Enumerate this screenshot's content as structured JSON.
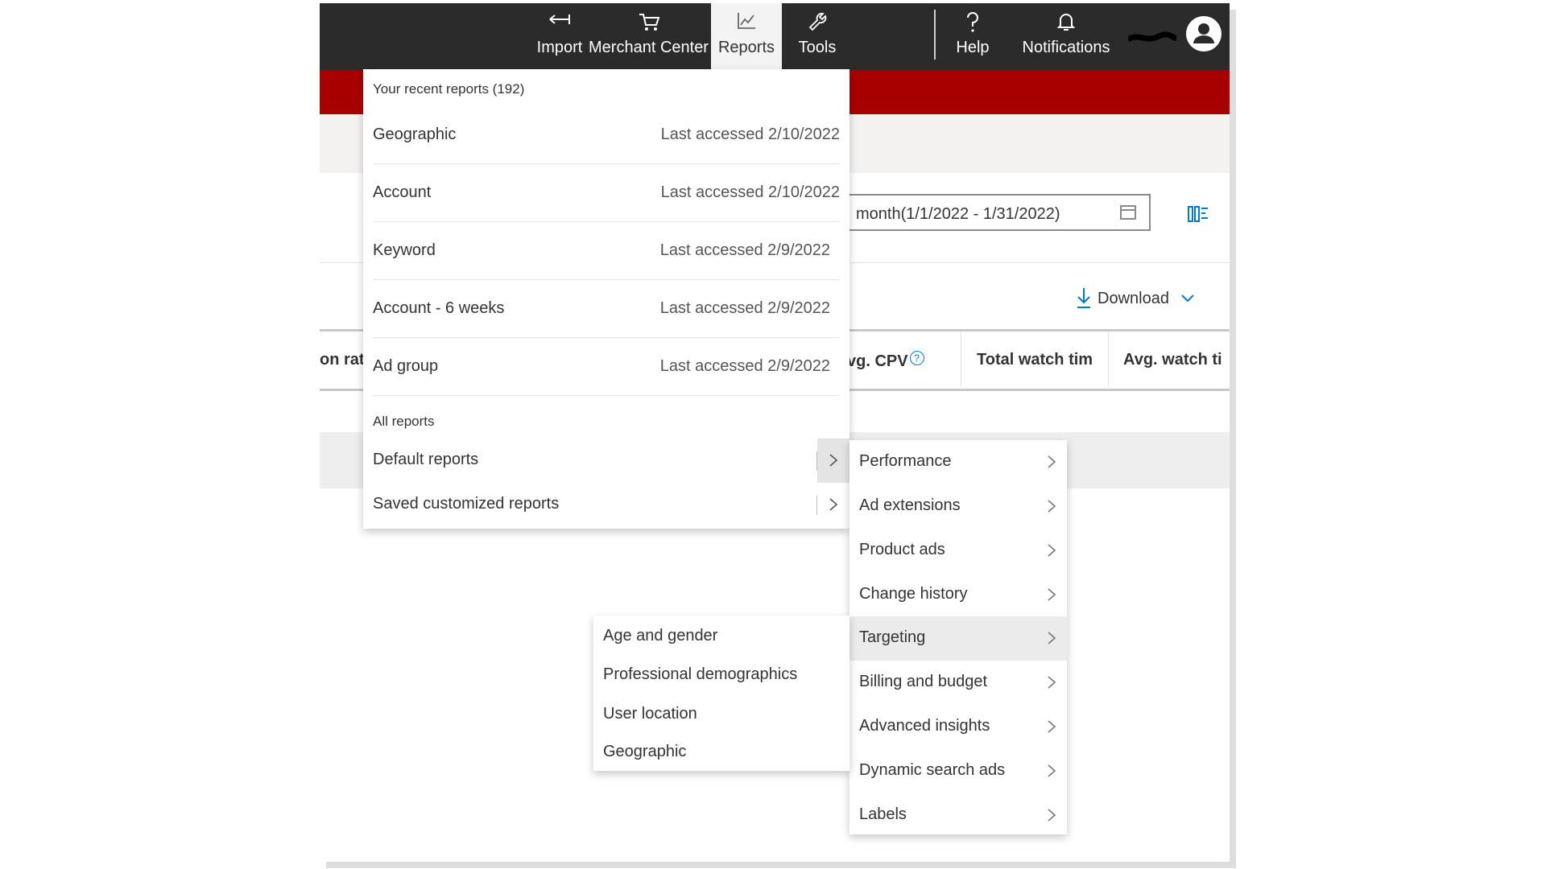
{
  "topnav": {
    "items": [
      {
        "label": "Import",
        "icon": "import-arrows-icon"
      },
      {
        "label": "Merchant Center",
        "icon": "shopping-cart-icon"
      },
      {
        "label": "Reports",
        "icon": "line-chart-icon",
        "active": true
      },
      {
        "label": "Tools",
        "icon": "wrench-icon"
      },
      {
        "label": "Help",
        "icon": "question-mark-icon"
      },
      {
        "label": "Notifications",
        "icon": "bell-icon"
      }
    ],
    "avatar_icon": "user-avatar-icon"
  },
  "toolbar": {
    "date_range": "month(1/1/2022 - 1/31/2022)",
    "calendar_icon": "calendar-icon",
    "columns_icon": "columns-icon",
    "download_label": "Download"
  },
  "grid": {
    "headers": [
      "on rat",
      "vg. CPV",
      "Total watch tim",
      "Avg. watch ti"
    ],
    "help_glyph": "?"
  },
  "reports_menu": {
    "recent_header": "Your recent reports (192)",
    "recent": [
      {
        "name": "Geographic",
        "accessed": "Last accessed 2/10/2022"
      },
      {
        "name": "Account",
        "accessed": "Last accessed 2/10/2022"
      },
      {
        "name": "Keyword",
        "accessed": "Last accessed 2/9/2022"
      },
      {
        "name": "Account - 6 weeks",
        "accessed": "Last accessed 2/9/2022"
      },
      {
        "name": "Ad group",
        "accessed": "Last accessed 2/9/2022"
      }
    ],
    "all_header": "All reports",
    "all": [
      {
        "name": "Default reports"
      },
      {
        "name": "Saved customized reports"
      }
    ]
  },
  "default_reports_menu": {
    "items": [
      {
        "label": "Performance"
      },
      {
        "label": "Ad extensions"
      },
      {
        "label": "Product ads"
      },
      {
        "label": "Change history"
      },
      {
        "label": "Targeting",
        "highlighted": true
      },
      {
        "label": "Billing and budget"
      },
      {
        "label": "Advanced insights"
      },
      {
        "label": "Dynamic search ads"
      },
      {
        "label": "Labels"
      }
    ]
  },
  "targeting_menu": {
    "items": [
      {
        "label": "Age and gender"
      },
      {
        "label": "Professional demographics"
      },
      {
        "label": "User location"
      },
      {
        "label": "Geographic"
      }
    ]
  },
  "colors": {
    "topbar": "#2b2b2b",
    "brand_red": "#a80000",
    "link_blue": "#0078d4"
  }
}
